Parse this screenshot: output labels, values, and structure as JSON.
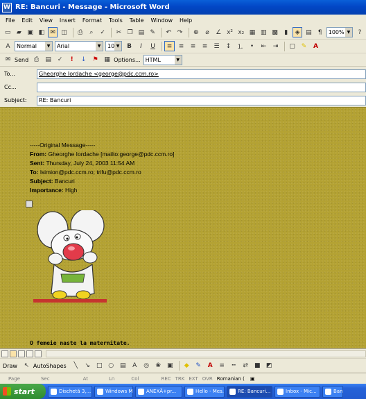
{
  "window": {
    "title": "RE: Bancuri - Message - Microsoft Word"
  },
  "menu": [
    "File",
    "Edit",
    "View",
    "Insert",
    "Format",
    "Tools",
    "Table",
    "Window",
    "Help"
  ],
  "toolbar": {
    "zoom": "100%",
    "style": "Normal",
    "font": "Arial",
    "size": "10"
  },
  "envelope": {
    "send_label": "Send",
    "options_label": "Options...",
    "format": "HTML",
    "to_label": "To...",
    "to_value": "Gheorghe Iordache <george@pdc.ccm.ro>",
    "cc_label": "Cc...",
    "cc_value": "",
    "subject_label": "Subject:",
    "subject_value": "RE: Bancuri"
  },
  "message": {
    "divider": "-----Original Message-----",
    "from_key": "From:",
    "from_val": "Gheorghe Iordache [mailto:george@pdc.ccm.ro]",
    "sent_key": "Sent:",
    "sent_val": "Thursday, July 24, 2003 11:54 AM",
    "to_key": "To:",
    "to_val": "lsimion@pdc.ccm.ro; trifu@pdc.ccm.ro",
    "subject_key": "Subject:",
    "subject_val": "Bancuri",
    "importance_key": "Importance:",
    "importance_val": "High",
    "footer": "O femeie naste la maternitate."
  },
  "drawing": {
    "draw_label": "Draw",
    "autoshapes_label": "AutoShapes"
  },
  "status": {
    "page": "Page",
    "sec": "Sec",
    "at": "At",
    "ln": "Ln",
    "col": "Col",
    "rec": "REC",
    "trk": "TRK",
    "ext": "EXT",
    "ovr": "OVR",
    "language": "Romanian ("
  },
  "taskbar": {
    "start": "start",
    "tasks": [
      "Dischetă 3,...",
      "Windows M...",
      "ANEXĂ+pr...",
      "Hello - Mes...",
      "RE: Bancuri...",
      "Inbox - Mic...",
      "Banc"
    ]
  }
}
